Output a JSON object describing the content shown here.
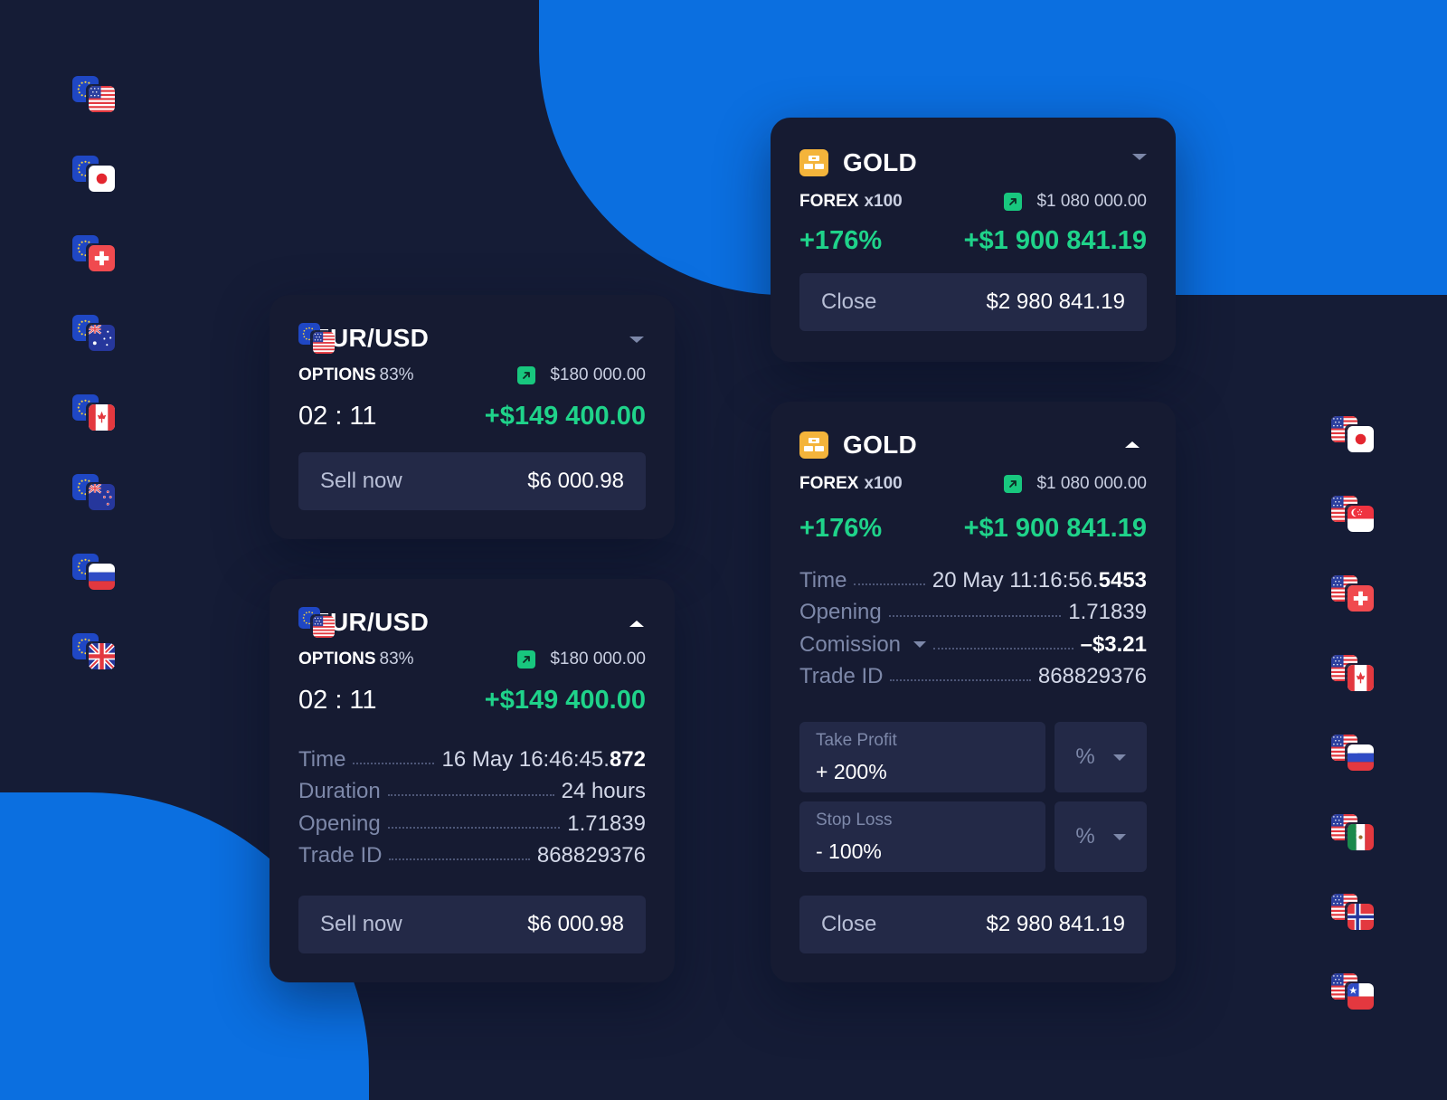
{
  "colors": {
    "background": "#151c36",
    "accent_blue": "#0b6fe0",
    "card": "#161b32",
    "positive": "#1fd38a",
    "gold": "#f4b43b"
  },
  "left_pairs": [
    "eur-usd",
    "eur-jpy",
    "eur-chf",
    "eur-aud",
    "eur-cad",
    "eur-nzd",
    "eur-rub",
    "eur-gbp"
  ],
  "right_pairs": [
    "usd-jpy",
    "usd-sgd",
    "usd-chf",
    "usd-cad",
    "usd-rub",
    "usd-mxn",
    "usd-nok",
    "usd-clp"
  ],
  "card_eur_collapsed": {
    "title": "EUR/USD",
    "type": "OPTIONS",
    "percent": "83%",
    "amount": "$180 000.00",
    "timer": "02 : 11",
    "profit": "+$149 400.00",
    "action_label": "Sell now",
    "action_value": "$6 000.98"
  },
  "card_eur_expanded": {
    "title": "EUR/USD",
    "type": "OPTIONS",
    "percent": "83%",
    "amount": "$180 000.00",
    "timer": "02 : 11",
    "profit": "+$149 400.00",
    "time_label": "Time",
    "time_value": "16 May 16:46:45.",
    "time_ms": "872",
    "duration_label": "Duration",
    "duration_value": "24 hours",
    "opening_label": "Opening",
    "opening_value": "1.71839",
    "trade_label": "Trade ID",
    "trade_value": "868829376",
    "action_label": "Sell now",
    "action_value": "$6 000.98"
  },
  "card_gold_collapsed": {
    "title": "GOLD",
    "type": "FOREX",
    "multiplier": "x100",
    "amount": "$1 080 000.00",
    "percent_change": "+176%",
    "profit": "+$1 900 841.19",
    "action_label": "Close",
    "action_value": "$2 980 841.19"
  },
  "card_gold_expanded": {
    "title": "GOLD",
    "type": "FOREX",
    "multiplier": "x100",
    "amount": "$1 080 000.00",
    "percent_change": "+176%",
    "profit": "+$1 900 841.19",
    "time_label": "Time",
    "time_value": "20 May 11:16:56.",
    "time_ms": "5453",
    "opening_label": "Opening",
    "opening_value": "1.71839",
    "commission_label": "Comission",
    "commission_value": "–$3.21",
    "trade_label": "Trade ID",
    "trade_value": "868829376",
    "take_profit_label": "Take Profit",
    "take_profit_value": "+ 200%",
    "take_profit_unit": "%",
    "stop_loss_label": "Stop Loss",
    "stop_loss_value": "- 100%",
    "stop_loss_unit": "%",
    "action_label": "Close",
    "action_value": "$2 980 841.19"
  }
}
